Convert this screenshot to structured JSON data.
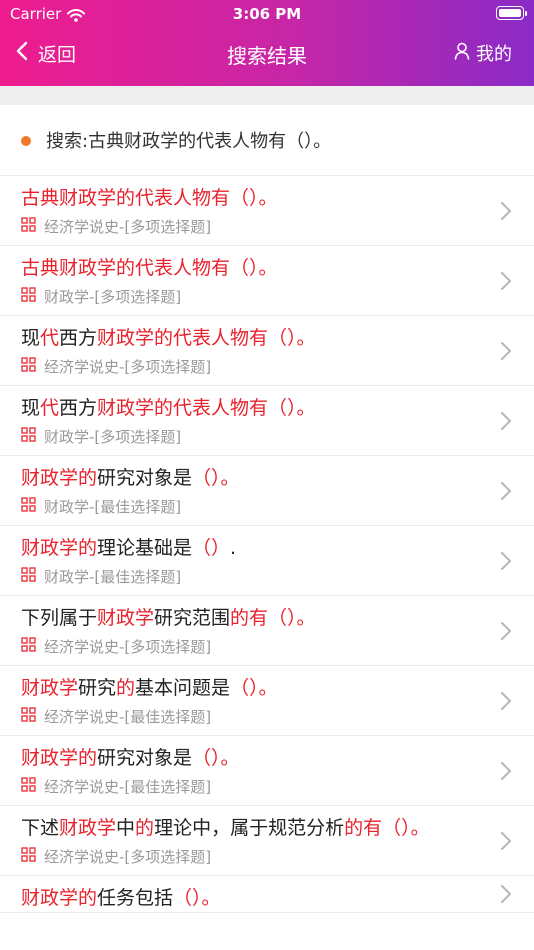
{
  "status_bar": {
    "carrier": "Carrier",
    "time": "3:06 PM"
  },
  "nav": {
    "back_label": "返回",
    "title": "搜索结果",
    "mine_label": "我的"
  },
  "query": {
    "text": "搜索:古典财政学的代表人物有（）。"
  },
  "colors": {
    "highlight": "#e8232d",
    "dot": "#ef7a2a",
    "gradient_start": "#ee1c8e",
    "gradient_end": "#8a2bc6"
  },
  "results": [
    {
      "segments": [
        {
          "t": "古典财政学的代表人物有（）。",
          "h": true
        }
      ],
      "meta": "经济学说史-[多项选择题]"
    },
    {
      "segments": [
        {
          "t": "古典财政学的代表人物有（）。",
          "h": true
        }
      ],
      "meta": "财政学-[多项选择题]"
    },
    {
      "segments": [
        {
          "t": "现",
          "h": false
        },
        {
          "t": "代",
          "h": true
        },
        {
          "t": "西方",
          "h": false
        },
        {
          "t": "财政学的代表人物有（）。",
          "h": true
        }
      ],
      "meta": "经济学说史-[多项选择题]"
    },
    {
      "segments": [
        {
          "t": "现",
          "h": false
        },
        {
          "t": "代",
          "h": true
        },
        {
          "t": "西方",
          "h": false
        },
        {
          "t": "财政学的代表人物有（）。",
          "h": true
        }
      ],
      "meta": "财政学-[多项选择题]"
    },
    {
      "segments": [
        {
          "t": "财政学的",
          "h": true
        },
        {
          "t": "研究对象是",
          "h": false
        },
        {
          "t": "（）。",
          "h": true
        }
      ],
      "meta": "财政学-[最佳选择题]"
    },
    {
      "segments": [
        {
          "t": "财政学的",
          "h": true
        },
        {
          "t": "理论基础是",
          "h": false
        },
        {
          "t": "（）",
          "h": true
        },
        {
          "t": ".",
          "h": false
        }
      ],
      "meta": "财政学-[最佳选择题]"
    },
    {
      "segments": [
        {
          "t": "下列属于",
          "h": false
        },
        {
          "t": "财政学",
          "h": true
        },
        {
          "t": "研究范围",
          "h": false
        },
        {
          "t": "的有（）。",
          "h": true
        }
      ],
      "meta": "经济学说史-[多项选择题]"
    },
    {
      "segments": [
        {
          "t": "财政学",
          "h": true
        },
        {
          "t": "研究",
          "h": false
        },
        {
          "t": "的",
          "h": true
        },
        {
          "t": "基本问题是",
          "h": false
        },
        {
          "t": "（）。",
          "h": true
        }
      ],
      "meta": "经济学说史-[最佳选择题]"
    },
    {
      "segments": [
        {
          "t": "财政学的",
          "h": true
        },
        {
          "t": "研究对象是",
          "h": false
        },
        {
          "t": "（）。",
          "h": true
        }
      ],
      "meta": "经济学说史-[最佳选择题]"
    },
    {
      "segments": [
        {
          "t": "下述",
          "h": false
        },
        {
          "t": "财政学",
          "h": true
        },
        {
          "t": "中",
          "h": false
        },
        {
          "t": "的",
          "h": true
        },
        {
          "t": "理论中，属于规范分析",
          "h": false
        },
        {
          "t": "的有（）。",
          "h": true
        }
      ],
      "meta": "经济学说史-[多项选择题]"
    },
    {
      "segments": [
        {
          "t": "财政学的",
          "h": true
        },
        {
          "t": "任务包括",
          "h": false
        },
        {
          "t": "（）。",
          "h": true
        }
      ],
      "meta": ""
    }
  ]
}
